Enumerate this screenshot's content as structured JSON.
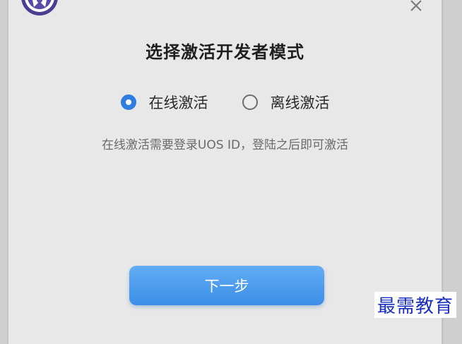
{
  "dialog": {
    "title": "选择激活开发者模式",
    "close_icon": "close-icon",
    "logo_icon": "app-logo-icon"
  },
  "options": [
    {
      "label": "在线激活",
      "checked": true
    },
    {
      "label": "离线激活",
      "checked": false
    }
  ],
  "hint": "在线激活需要登录UOS ID，登陆之后即可激活",
  "next_button": {
    "label": "下一步"
  },
  "watermark": "最需教育",
  "colors": {
    "accent": "#2e7de0",
    "button_top": "#62adf4",
    "button_bottom": "#3b8ee6",
    "watermark": "#1a2fbf"
  }
}
